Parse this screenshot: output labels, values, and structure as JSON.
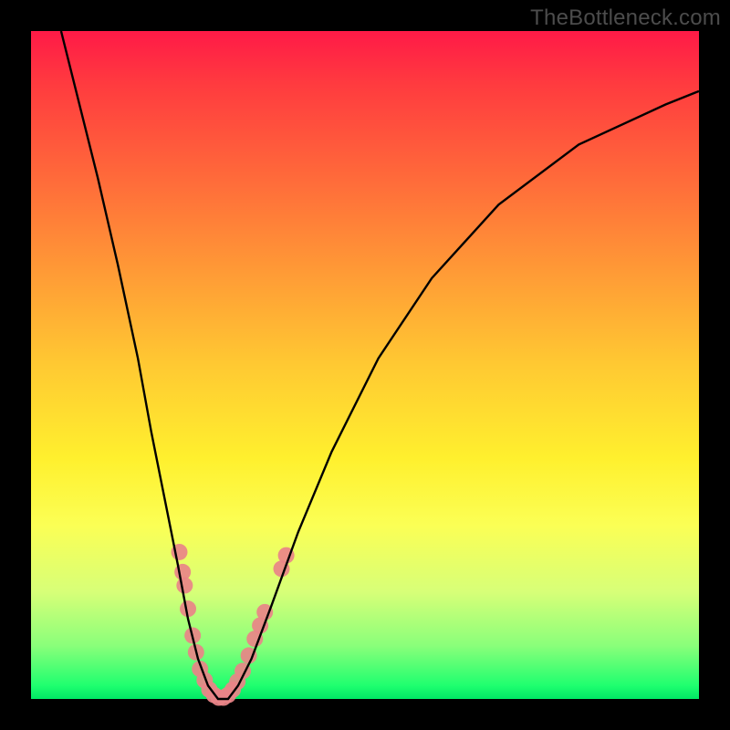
{
  "watermark": "TheBottleneck.com",
  "colors": {
    "frame": "#000000",
    "curve": "#000000",
    "marker_fill": "#e98488",
    "marker_stroke": "#e98488",
    "gradient_top": "#ff1a47",
    "gradient_bottom": "#00e865"
  },
  "chart_data": {
    "type": "line",
    "title": "",
    "xlabel": "",
    "ylabel": "",
    "xlim": [
      0,
      100
    ],
    "ylim": [
      0,
      100
    ],
    "curve": [
      {
        "x": 4.5,
        "y": 100
      },
      {
        "x": 7,
        "y": 90
      },
      {
        "x": 10,
        "y": 78
      },
      {
        "x": 13,
        "y": 65
      },
      {
        "x": 16,
        "y": 51
      },
      {
        "x": 18,
        "y": 40
      },
      {
        "x": 20,
        "y": 30
      },
      {
        "x": 22,
        "y": 20
      },
      {
        "x": 23.5,
        "y": 12
      },
      {
        "x": 25,
        "y": 6
      },
      {
        "x": 26.5,
        "y": 2
      },
      {
        "x": 28,
        "y": 0
      },
      {
        "x": 29.5,
        "y": 0
      },
      {
        "x": 31,
        "y": 2
      },
      {
        "x": 33,
        "y": 6
      },
      {
        "x": 36,
        "y": 14
      },
      {
        "x": 40,
        "y": 25
      },
      {
        "x": 45,
        "y": 37
      },
      {
        "x": 52,
        "y": 51
      },
      {
        "x": 60,
        "y": 63
      },
      {
        "x": 70,
        "y": 74
      },
      {
        "x": 82,
        "y": 83
      },
      {
        "x": 95,
        "y": 89
      },
      {
        "x": 100,
        "y": 91
      }
    ],
    "markers": [
      {
        "x": 22.2,
        "y": 22.0
      },
      {
        "x": 22.7,
        "y": 19.0
      },
      {
        "x": 23.0,
        "y": 17.0
      },
      {
        "x": 23.5,
        "y": 13.5
      },
      {
        "x": 24.2,
        "y": 9.5
      },
      {
        "x": 24.7,
        "y": 7.0
      },
      {
        "x": 25.3,
        "y": 4.5
      },
      {
        "x": 26.0,
        "y": 2.8
      },
      {
        "x": 26.7,
        "y": 1.4
      },
      {
        "x": 27.4,
        "y": 0.6
      },
      {
        "x": 28.1,
        "y": 0.2
      },
      {
        "x": 28.8,
        "y": 0.2
      },
      {
        "x": 29.5,
        "y": 0.6
      },
      {
        "x": 30.2,
        "y": 1.4
      },
      {
        "x": 30.9,
        "y": 2.6
      },
      {
        "x": 31.7,
        "y": 4.2
      },
      {
        "x": 32.6,
        "y": 6.5
      },
      {
        "x": 33.5,
        "y": 9.0
      },
      {
        "x": 34.3,
        "y": 11.0
      },
      {
        "x": 35.0,
        "y": 13.0
      },
      {
        "x": 37.5,
        "y": 19.5
      },
      {
        "x": 38.2,
        "y": 21.5
      }
    ],
    "marker_radius": 9
  }
}
